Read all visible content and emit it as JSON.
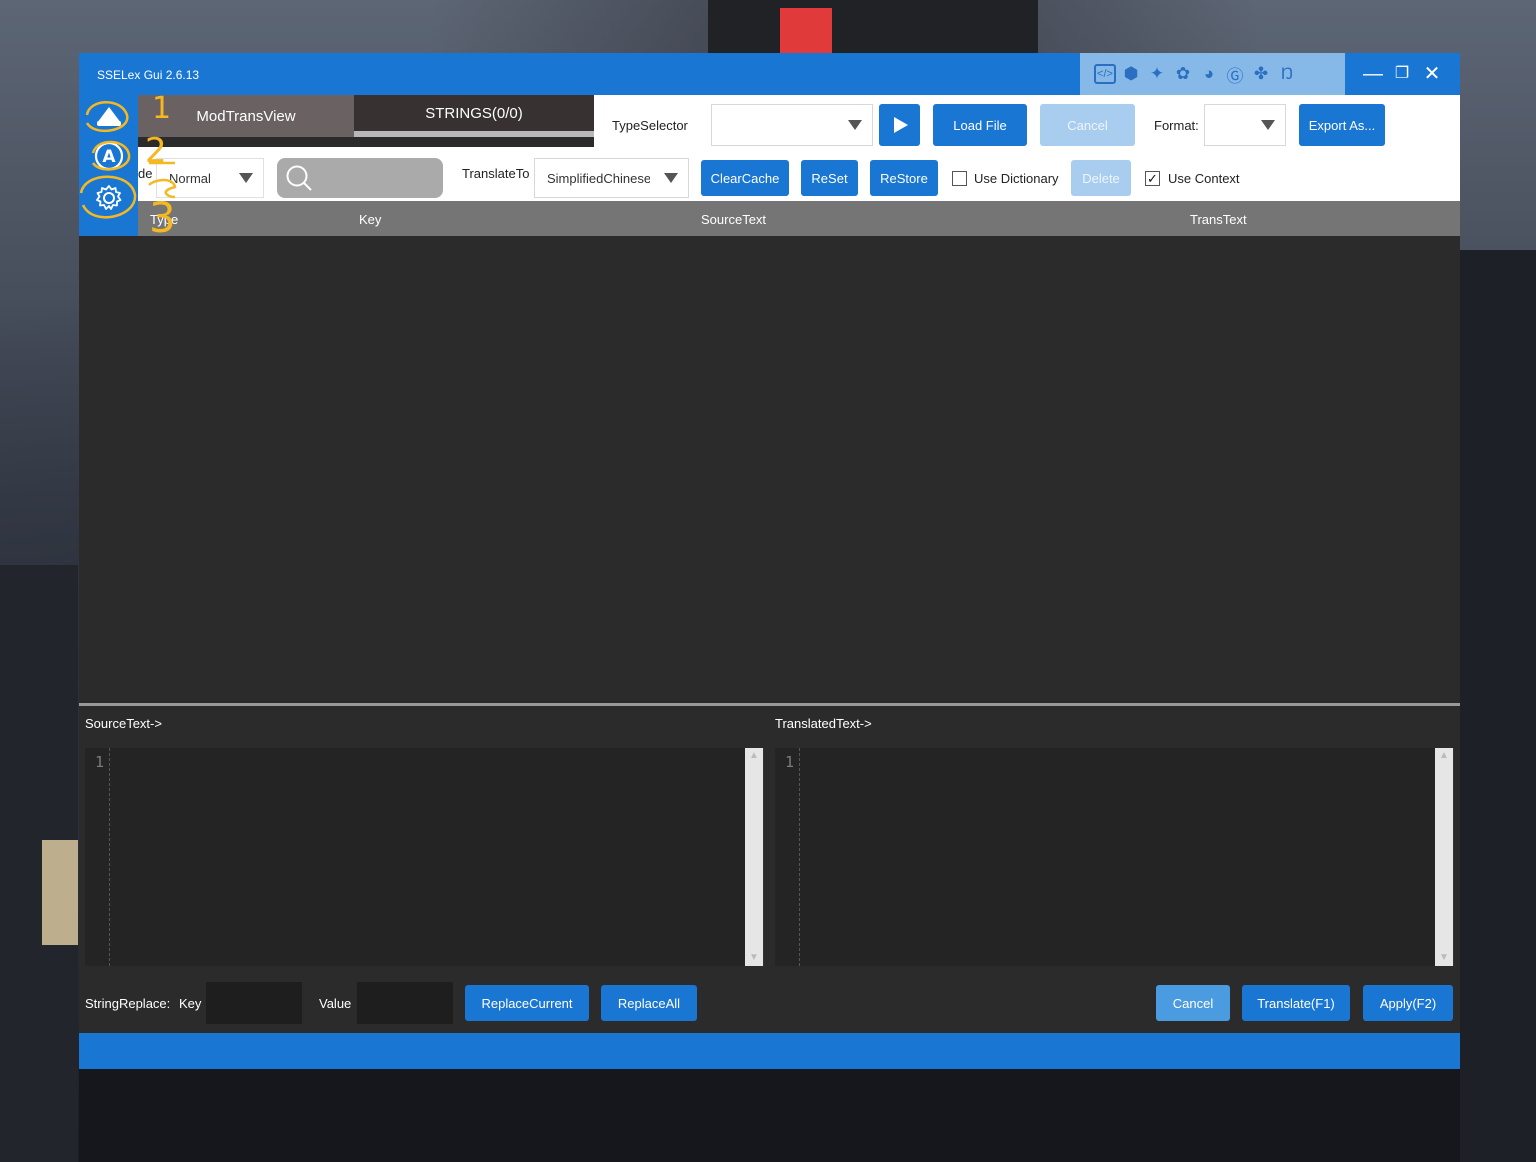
{
  "window": {
    "title": "SSELex Gui 2.6.13"
  },
  "titlebar_icons": [
    "code-window-icon",
    "shield-icon",
    "sparkle-icon",
    "openai-icon",
    "deepseek-icon",
    "google-icon",
    "baidu-paw-icon",
    "n-logo-icon"
  ],
  "tabs": [
    {
      "label": "ModTransView"
    },
    {
      "label": "STRINGS(0/0)"
    }
  ],
  "toolbar": {
    "type_selector_label": "TypeSelector",
    "type_selector_value": "",
    "load_file": "Load File",
    "cancel": "Cancel",
    "format_label": "Format:",
    "format_value": "",
    "export": "Export As..."
  },
  "toolbar2": {
    "mode_label_partial": "de",
    "mode_value": "Normal",
    "search_value": "",
    "translate_to_label": "TranslateTo",
    "translate_to_value": "SimplifiedChinese",
    "clear_cache": "ClearCache",
    "reset": "ReSet",
    "restore": "ReStore",
    "use_dictionary": "Use Dictionary",
    "use_dictionary_checked": false,
    "delete": "Delete",
    "use_context": "Use Context",
    "use_context_checked": true
  },
  "grid": {
    "columns": [
      "Type",
      "Key",
      "SourceText",
      "TransText"
    ],
    "rows": []
  },
  "editors": {
    "source_label": "SourceText->",
    "translated_label": "TranslatedText->",
    "source_line": "1",
    "translated_line": "1"
  },
  "string_replace": {
    "label": "StringReplace:",
    "key_label": "Key",
    "value_label": "Value",
    "key_value": "",
    "value_value": "",
    "replace_current": "ReplaceCurrent",
    "replace_all": "ReplaceAll"
  },
  "actions": {
    "cancel": "Cancel",
    "translate": "Translate(F1)",
    "apply": "Apply(F2)"
  },
  "annotations": [
    "1",
    "2",
    "3"
  ],
  "colors": {
    "accent": "#1976d2",
    "accent_disabled": "#a9cdee",
    "annotation": "#f5b820"
  }
}
